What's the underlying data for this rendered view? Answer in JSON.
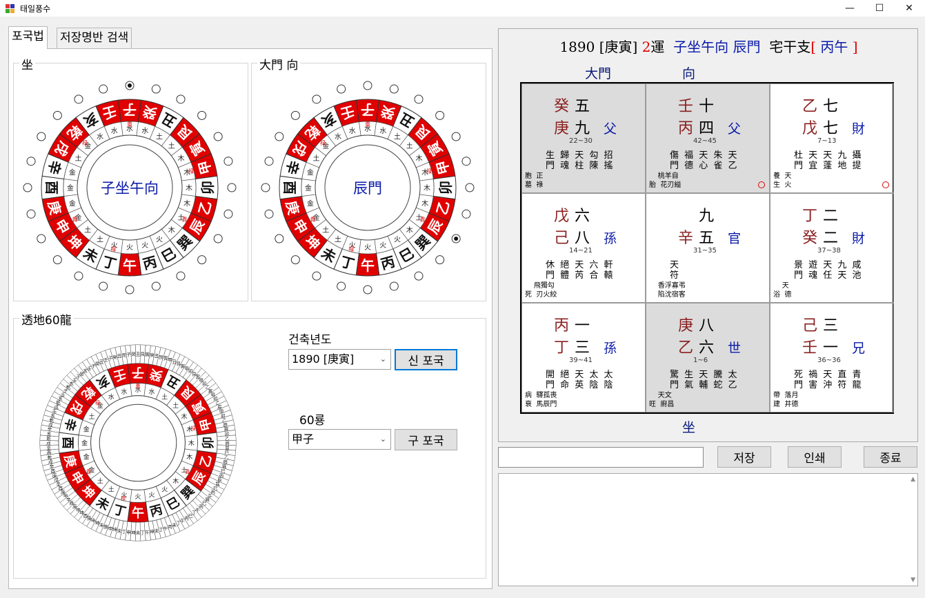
{
  "window": {
    "title": "태일풍수",
    "minimize": "—",
    "maximize": "☐",
    "close": "✕"
  },
  "tabs": [
    {
      "label": "포국법"
    },
    {
      "label": "저장명반 검색"
    }
  ],
  "left": {
    "sit_group": "坐",
    "gate_group": "大門 向",
    "sit_center": "子坐午向",
    "gate_center": "辰門",
    "dragon_group": "透地60龍",
    "build_year_label": "건축년도",
    "build_year_value": "1890 [庚寅]",
    "new_method_button": "신 포국",
    "dragon_label": "60룡",
    "dragon_value": "甲子",
    "old_method_button": "구 포국"
  },
  "rings": {
    "outer": [
      "子",
      "癸",
      "丑",
      "艮",
      "寅",
      "甲",
      "卯",
      "乙",
      "辰",
      "巽",
      "巳",
      "丙",
      "午",
      "丁",
      "未",
      "坤",
      "申",
      "庚",
      "酉",
      "辛",
      "戌",
      "乾",
      "亥",
      "壬"
    ],
    "red": [
      true,
      true,
      false,
      true,
      true,
      true,
      false,
      true,
      true,
      false,
      false,
      false,
      true,
      false,
      false,
      true,
      true,
      true,
      false,
      false,
      true,
      true,
      false,
      true
    ],
    "inner": [
      "水",
      "水",
      "土",
      "土",
      "木",
      "木",
      "木",
      "木",
      "土",
      "木",
      "火",
      "火",
      "火",
      "火",
      "土",
      "土",
      "金",
      "金",
      "金",
      "金",
      "土",
      "金",
      "水",
      "水"
    ],
    "middle": [
      "貴",
      "",
      "",
      "",
      "",
      "禄",
      "",
      "",
      "貴",
      "",
      "",
      "",
      "",
      "禄",
      "",
      "",
      "貴",
      "",
      "",
      "",
      "",
      "禄",
      "",
      ""
    ]
  },
  "chart": {
    "header": {
      "year": "1890",
      "ganzhi": "[庚寅]",
      "unit": "2",
      "unit_suffix": "運",
      "direction": "子坐午向",
      "gate": "辰門",
      "house_label": "宅干支",
      "house_open": "[",
      "house_value": "丙午",
      "house_close": "]"
    },
    "top_label_gate": "大門",
    "top_label_to": "向",
    "bottom_label": "坐",
    "cells": [
      {
        "s1": "癸",
        "n1": "五",
        "s2": "庚",
        "n2": "九",
        "rel": "父",
        "range": "22~30",
        "row1": "生 歸 天 勾 招",
        "row2": "門 魂 柱 陳 搖",
        "t1": "胞  正",
        "t2": "墓  祿",
        "ring": false
      },
      {
        "s1": "壬",
        "n1": "十",
        "s2": "丙",
        "n2": "四",
        "rel": "父",
        "range": "42~45",
        "row1": "傷 福 天 朱 天",
        "row2": "門 德 心 雀 乙",
        "t1": "    桃羊自",
        "t2": "胎  花刃縊",
        "ring": true
      },
      {
        "s1": "乙",
        "n1": "七",
        "s2": "戊",
        "n2": "七",
        "rel": "財",
        "range": "7~13",
        "row1": "杜 天 天 九 攝",
        "row2": "門 宜 蓬 地 提",
        "t1": "養  天",
        "t2": "生  火",
        "ring": true
      },
      {
        "s1": "戊",
        "n1": "六",
        "s2": "己",
        "n2": "八",
        "rel": "孫",
        "range": "14~21",
        "row1": "休 絕 天 六 軒",
        "row2": "門 體 芮 合 轅",
        "t1": "    飛獨勾",
        "t2": "死  刃火絞",
        "ring": false
      },
      {
        "s1": "",
        "n1": "九",
        "s2": "辛",
        "n2": "五",
        "rel": "官",
        "range": "31~35",
        "row1": "            天",
        "row2": "            符",
        "t1": "    香浮寡弔",
        "t2": "    陷沈宿客",
        "ring": false
      },
      {
        "s1": "丁",
        "n1": "二",
        "s2": "癸",
        "n2": "二",
        "rel": "財",
        "range": "37~38",
        "row1": "景 遊 天 九 咸",
        "row2": "門 魂 任 天 池",
        "t1": "    天",
        "t2": "浴  德",
        "ring": false
      },
      {
        "s1": "丙",
        "n1": "一",
        "s2": "丁",
        "n2": "三",
        "rel": "孫",
        "range": "39~41",
        "row1": "開 絕 天 太 太",
        "row2": "門 命 英 陰 陰",
        "t1": "病  驛孤喪",
        "t2": "衰  馬辰門",
        "ring": false
      },
      {
        "s1": "庚",
        "n1": "八",
        "s2": "乙",
        "n2": "六",
        "rel": "世",
        "range": "1~6",
        "row1": "驚 生 天 騰 太",
        "row2": "門 氣 輔 蛇 乙",
        "t1": "    天文",
        "t2": "旺  廚昌",
        "ring": false
      },
      {
        "s1": "己",
        "n1": "三",
        "s2": "壬",
        "n2": "一",
        "rel": "兄",
        "range": "36~36",
        "row1": "死 禍 天 直 青",
        "row2": "門 害 沖 符 龍",
        "t1": "帶  落月",
        "t2": "建  井德",
        "ring": false
      }
    ]
  },
  "bottom_buttons": {
    "save": "저장",
    "print": "인쇄",
    "exit": "종료"
  },
  "colors": {
    "red": "#e00000",
    "blue": "#0a1aa8",
    "shaded": "#dcdcdc",
    "accent": "#0078d7"
  }
}
